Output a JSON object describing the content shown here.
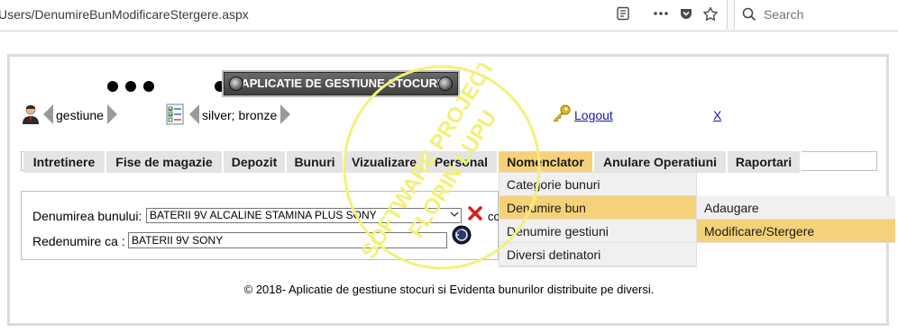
{
  "browser": {
    "url": "Users/DenumireBunModificareStergere.aspx",
    "search_placeholder": "Search"
  },
  "header": {
    "app_title": "APLICATIE DE GESTIUNE STOCURI",
    "user_label": "gestiune",
    "roles_label": "silver; bronze",
    "logout_label": "Logout",
    "close_label": "X"
  },
  "menu": {
    "items": [
      "Intretinere",
      "Fise de magazie",
      "Depozit",
      "Bunuri",
      "Vizualizare",
      "Personal",
      "Nomenclator",
      "Anulare Operatiuni",
      "Raportari"
    ],
    "active": "Nomenclator",
    "submenu": [
      "Categorie bunuri",
      "Denumire bun",
      "Denumire gestiuni",
      "Diversi detinatori"
    ],
    "submenu_active": "Denumire bun",
    "subsubmenu": [
      "Adaugare",
      "Modificare/Stergere"
    ],
    "subsubmenu_active": "Modificare/Stergere"
  },
  "form": {
    "denumire_label": "Denumirea bunului:",
    "denumire_value": "BATERII 9V  ALCALINE STAMINA PLUS SONY",
    "delete_partial_text": "co",
    "redenumire_label": "Redenumire ca :",
    "redenumire_value": "BATERII 9V  SONY"
  },
  "footer": {
    "text": "© 2018- Aplicatie de gestiune stocuri si Evidenta bunurilor distribuite pe diversi."
  },
  "watermark": {
    "line1": "SOFTWARE PROJECT",
    "line2": "FLORIN LUPU",
    "color": "#f3f07a"
  },
  "colors": {
    "menu_bg": "#e4e4e4",
    "menu_active": "#f5d27a",
    "link": "#1a1aa6",
    "delete_red": "#d62020"
  }
}
